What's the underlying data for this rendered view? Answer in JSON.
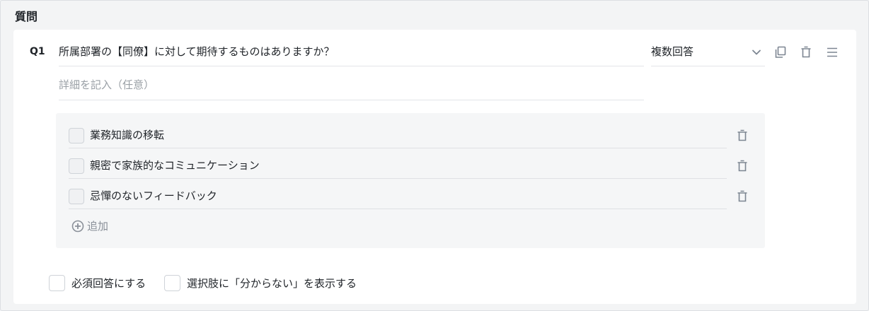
{
  "section": {
    "title": "質問"
  },
  "question": {
    "number": "Q1",
    "title": "所属部署の【同僚】に対して期待するものはありますか？",
    "description_placeholder": "詳細を記入（任意）",
    "answer_type": "複数回答"
  },
  "toolbar": {
    "icons": [
      "chevron-down-icon",
      "copy-icon",
      "trash-icon",
      "drag-handle-icon"
    ]
  },
  "options": [
    {
      "label": "業務知識の移転"
    },
    {
      "label": "親密で家族的なコミュニケーション"
    },
    {
      "label": "忌憚のないフィードバック"
    }
  ],
  "add_option": {
    "label": "追加"
  },
  "footer": {
    "required_label": "必須回答にする",
    "show_unknown_label": "選択肢に「分からない」を表示する"
  },
  "colors": {
    "background": "#f3f4f5",
    "card": "#ffffff",
    "options_bg": "#f5f6f7",
    "icon": "#7c8591",
    "muted_text": "#9aa0a6"
  }
}
